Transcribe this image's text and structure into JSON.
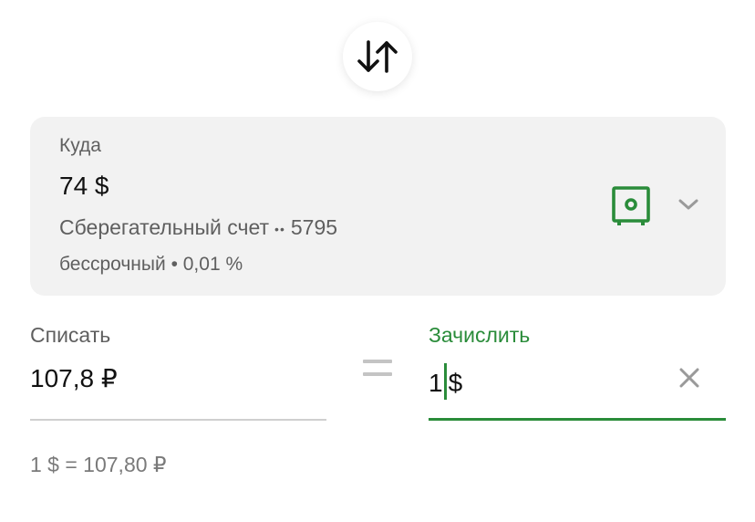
{
  "swap": {
    "icon": "swap-arrows-icon"
  },
  "destination": {
    "label": "Куда",
    "amount": "74 $",
    "account_name": "Сберегательный счет",
    "account_mask": "••",
    "account_number": "5795",
    "term": "бессрочный • 0,01 %",
    "account_icon": "safe-icon",
    "expand_icon": "chevron-down-icon"
  },
  "debit": {
    "label": "Списать",
    "value": "107,8 ₽"
  },
  "credit": {
    "label": "Зачислить",
    "value_before_caret": "1",
    "value_after_caret": "$",
    "clear_icon": "close-icon"
  },
  "exchange_rate": "1 $ = 107,80 ₽",
  "colors": {
    "accent": "#2a8c3a",
    "card_bg": "#f2f2f2",
    "muted_text": "#5f5f5f",
    "divider": "#cfcfcf"
  }
}
